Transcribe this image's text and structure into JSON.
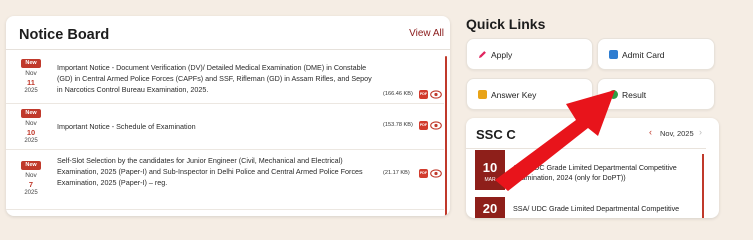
{
  "notice_board": {
    "title": "Notice Board",
    "view_all": "View All",
    "items": [
      {
        "badge": "New",
        "month": "Nov",
        "day": "11",
        "year": "2025",
        "text": "Important Notice - Document Verification (DV)/ Detailed Medical Examination (DME) in Constable (GD) in Central Armed Police Forces (CAPFs) and SSF, Rifleman (GD) in Assam Rifles, and Sepoy in Narcotics Control Bureau Examination, 2025.",
        "size": "(166.46 KB)",
        "pdf": "PDF"
      },
      {
        "badge": "New",
        "month": "Nov",
        "day": "10",
        "year": "2025",
        "text": "Important Notice - Schedule of Examination",
        "size": "(153.78 KB)",
        "pdf": "PDF"
      },
      {
        "badge": "New",
        "month": "Nov",
        "day": "7",
        "year": "2025",
        "text": "Self-Slot Selection by the candidates for Junior Engineer (Civil, Mechanical and Electrical) Examination, 2025 (Paper-I) and Sub-Inspector in Delhi Police and Central Armed Police Forces Examination, 2025 (Paper-I) – reg.",
        "size": "(21.17 KB)",
        "pdf": "PDF"
      }
    ]
  },
  "quick_links": {
    "title": "Quick Links",
    "buttons": [
      {
        "label": "Apply",
        "icon": "pencil-icon",
        "color": "#e0245e"
      },
      {
        "label": "Admit Card",
        "icon": "id-card-icon",
        "color": "#2e7dd1"
      },
      {
        "label": "Answer Key",
        "icon": "key-icon",
        "color": "#e8a317"
      },
      {
        "label": "Result",
        "icon": "result-icon",
        "color": "#2e9e44"
      }
    ]
  },
  "calendar": {
    "title": "SSC C",
    "month": "Nov, 2025",
    "events": [
      {
        "day": "10",
        "mon": "MAR",
        "text": "JSA/ LDC Grade Limited Departmental Competitive Examination, 2024 (only for DoPT))"
      },
      {
        "day": "20",
        "mon": "",
        "text": "SSA/ UDC Grade Limited Departmental Competitive"
      }
    ]
  },
  "colors": {
    "accent": "#c0392b",
    "arrow": "#e8141b",
    "background": "#f5ede4"
  }
}
